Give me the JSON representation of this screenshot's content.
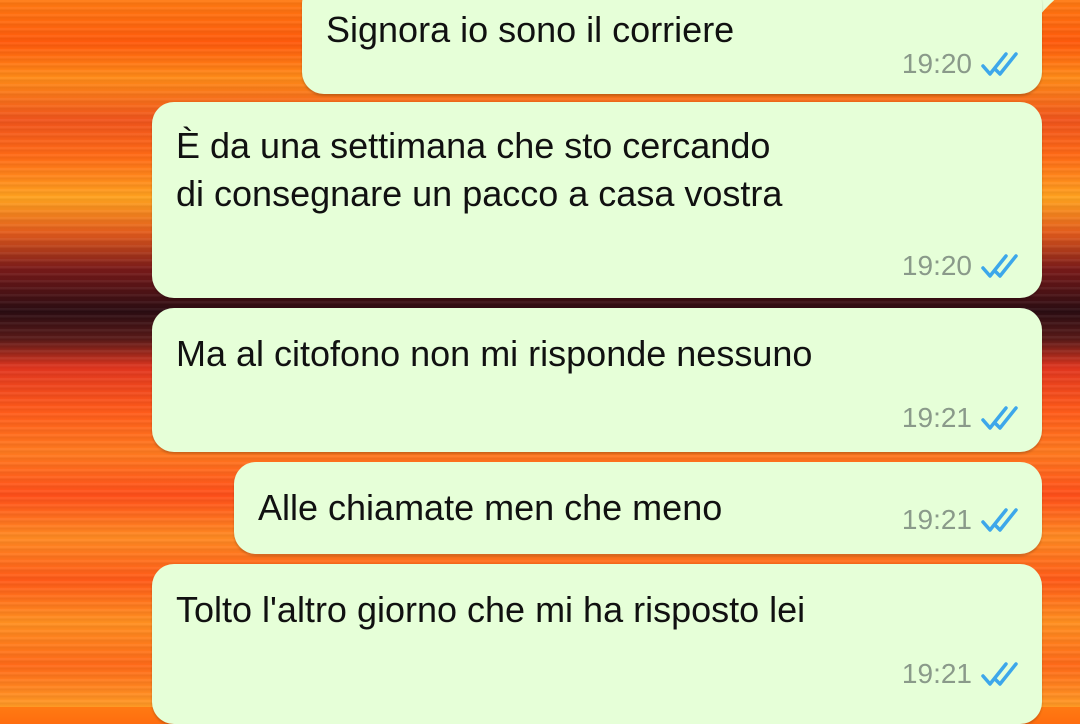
{
  "chat": {
    "messages": [
      {
        "text": "Signora io sono il corriere",
        "time": "19:20",
        "status_icon": "double-check-icon"
      },
      {
        "text": "È da una settimana che sto cercando\ndi consegnare un pacco a casa vostra",
        "time": "19:20",
        "status_icon": "double-check-icon"
      },
      {
        "text": "Ma al citofono non mi risponde nessuno",
        "time": "19:21",
        "status_icon": "double-check-icon"
      },
      {
        "text": "Alle chiamate men che meno",
        "time": "19:21",
        "status_icon": "double-check-icon"
      },
      {
        "text": "Tolto l'altro giorno che mi ha risposto lei",
        "time": "19:21",
        "status_icon": "double-check-icon"
      }
    ]
  },
  "colors": {
    "bubble_background": "#e6ffd8",
    "read_tick": "#3da7ea",
    "meta_text": "#8a9a8a"
  }
}
